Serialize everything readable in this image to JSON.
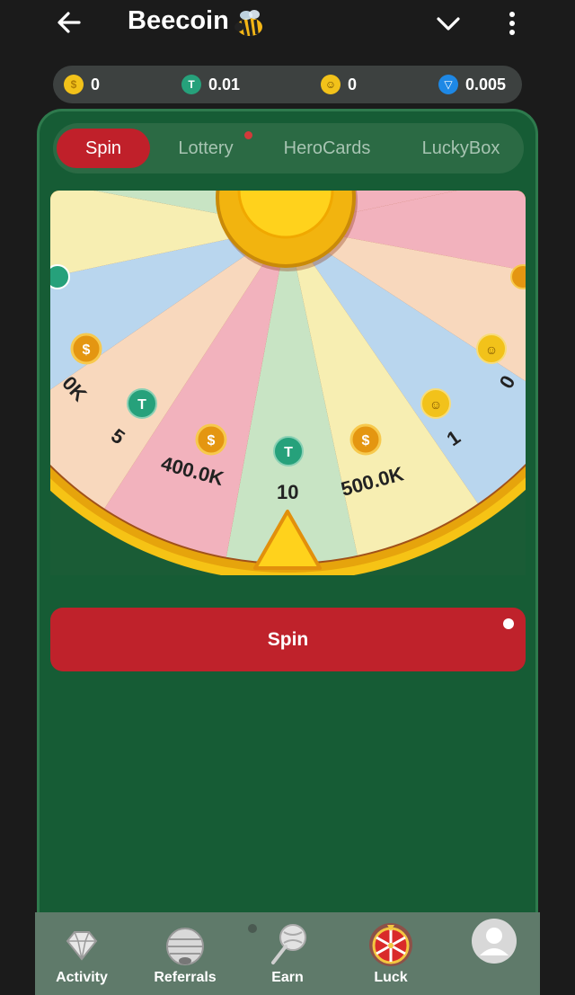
{
  "header": {
    "title": "Beecoin",
    "title_emoji": "🐝"
  },
  "balances": [
    {
      "icon": "dollar-coin-icon",
      "value": "0",
      "color": "#f2c21a",
      "glyph": "$"
    },
    {
      "icon": "tether-icon",
      "value": "0.01",
      "color": "#26a17b",
      "glyph": "T"
    },
    {
      "icon": "bee-coin-icon",
      "value": "0",
      "color": "#f2c21a",
      "glyph": "☺"
    },
    {
      "icon": "ton-diamond-icon",
      "value": "0.005",
      "color": "#1e88e5",
      "glyph": "▽"
    }
  ],
  "tabs": [
    {
      "label": "Spin",
      "active": true
    },
    {
      "label": "Lottery",
      "active": false
    },
    {
      "label": "HeroCards",
      "active": false
    },
    {
      "label": "LuckyBox",
      "active": false
    }
  ],
  "wheel": {
    "segments": [
      {
        "label": "0K",
        "icon": "dollar"
      },
      {
        "label": "5",
        "icon": "tether"
      },
      {
        "label": "400.0K",
        "icon": "dollar"
      },
      {
        "label": "10",
        "icon": "tether"
      },
      {
        "label": "500.0K",
        "icon": "dollar"
      },
      {
        "label": "1",
        "icon": "bee"
      },
      {
        "label": "0",
        "icon": "bee"
      }
    ]
  },
  "actions": {
    "spin_label": "Spin"
  },
  "nav": [
    {
      "label": "Activity",
      "icon": "diamond-icon"
    },
    {
      "label": "Referrals",
      "icon": "hive-icon"
    },
    {
      "label": "Earn",
      "icon": "lollipop-icon"
    },
    {
      "label": "Luck",
      "icon": "fortune-wheel-icon"
    },
    {
      "label": "",
      "icon": "profile-avatar-icon"
    }
  ],
  "colors": {
    "accent_red": "#bf222b",
    "panel_green": "#165c35",
    "gold": "#f5c11a"
  }
}
